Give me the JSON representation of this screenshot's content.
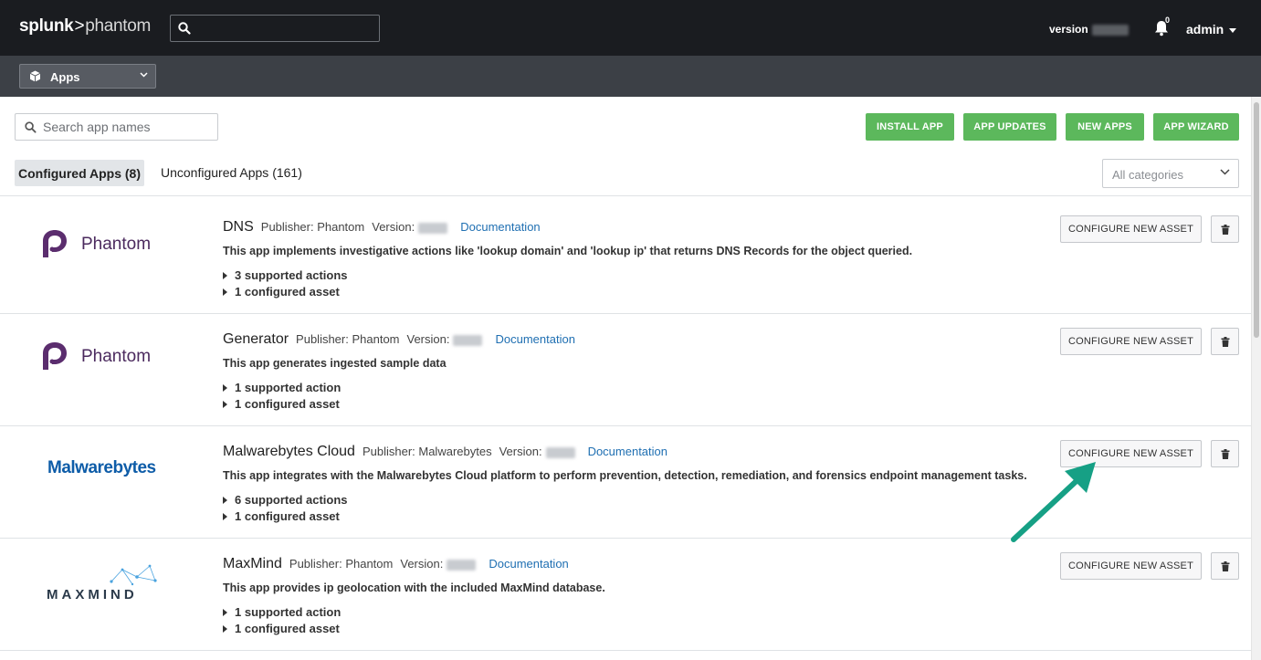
{
  "header": {
    "logo_brand": "splunk",
    "logo_sep": ">",
    "logo_product": "phantom",
    "search_icon": "search-icon",
    "version_label": "version",
    "notification_count": "0",
    "user": "admin"
  },
  "subnav": {
    "section_label": "Apps",
    "icon": "cube-icon"
  },
  "toolbar": {
    "search_placeholder": "Search app names",
    "buttons": [
      "INSTALL APP",
      "APP UPDATES",
      "NEW APPS",
      "APP WIZARD"
    ],
    "button_color": "#5cb85c"
  },
  "tabs": {
    "configured": "Configured Apps (8)",
    "unconfigured": "Unconfigured Apps (161)"
  },
  "category_select": {
    "selected": "All categories"
  },
  "apps": [
    {
      "logo": "Phantom",
      "name": "DNS",
      "publisher": "Publisher: Phantom",
      "version_label": "Version:",
      "doc": "Documentation",
      "description": "This app implements investigative actions like 'lookup domain' and 'lookup ip' that returns DNS Records for the object queried.",
      "actions": "3 supported actions",
      "assets": "1 configured asset",
      "configure": "CONFIGURE NEW ASSET"
    },
    {
      "logo": "Phantom",
      "name": "Generator",
      "publisher": "Publisher: Phantom",
      "version_label": "Version:",
      "doc": "Documentation",
      "description": "This app generates ingested sample data",
      "actions": "1 supported action",
      "assets": "1 configured asset",
      "configure": "CONFIGURE NEW ASSET"
    },
    {
      "logo": "Malwarebytes",
      "name": "Malwarebytes Cloud",
      "publisher": "Publisher: Malwarebytes",
      "version_label": "Version:",
      "doc": "Documentation",
      "description": "This app integrates with the Malwarebytes Cloud platform to perform prevention, detection, remediation, and forensics endpoint management tasks.",
      "actions": "6 supported actions",
      "assets": "1 configured asset",
      "configure": "CONFIGURE NEW ASSET"
    },
    {
      "logo": "MAXMIND",
      "name": "MaxMind",
      "publisher": "Publisher: Phantom",
      "version_label": "Version:",
      "doc": "Documentation",
      "description": "This app provides ip geolocation with the included MaxMind database.",
      "actions": "1 supported action",
      "assets": "1 configured asset",
      "configure": "CONFIGURE NEW ASSET"
    }
  ],
  "annotation_color": "#16a085"
}
